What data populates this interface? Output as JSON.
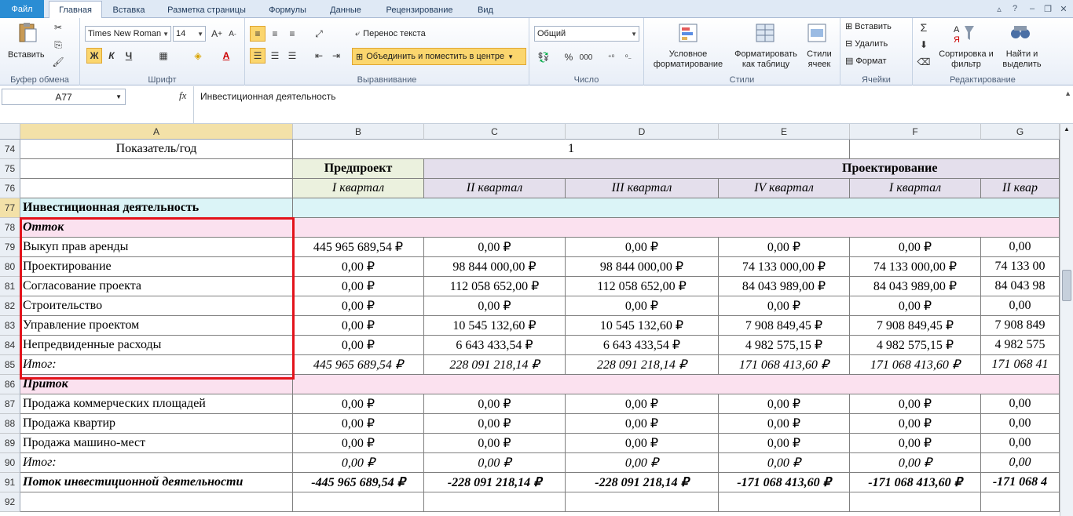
{
  "tabs": [
    "Файл",
    "Главная",
    "Вставка",
    "Разметка страницы",
    "Формулы",
    "Данные",
    "Рецензирование",
    "Вид"
  ],
  "ribbon": {
    "clipboard": {
      "paste": "Вставить",
      "label": "Буфер обмена"
    },
    "font": {
      "name": "Times New Roman",
      "size": "14",
      "bold": "Ж",
      "italic": "К",
      "underline": "Ч",
      "label": "Шрифт"
    },
    "alignment": {
      "wrap": "Перенос текста",
      "merge": "Объединить и поместить в центре",
      "label": "Выравнивание"
    },
    "number": {
      "format": "Общий",
      "percent": "%",
      "thousands": "000",
      "label": "Число"
    },
    "styles": {
      "conditional": "Условное форматирование",
      "as_table": "Форматировать как таблицу",
      "cell_styles": "Стили ячеек",
      "label": "Стили"
    },
    "cells": {
      "insert": "Вставить",
      "delete": "Удалить",
      "format": "Формат",
      "label": "Ячейки"
    },
    "editing": {
      "sort": "Сортировка и фильтр",
      "find": "Найти и выделить",
      "label": "Редактирование"
    }
  },
  "formula_bar": {
    "name_box": "A77",
    "fx": "fx",
    "content": "Инвестиционная деятельность"
  },
  "columns": [
    "A",
    "B",
    "C",
    "D",
    "E",
    "F",
    "G"
  ],
  "header_rows": {
    "r74": {
      "num": "74",
      "a": "Показатель/год",
      "year": "1"
    },
    "r75": {
      "num": "75",
      "b": "Предпроект",
      "c_g": "Проектирование"
    },
    "r76": {
      "num": "76",
      "b": "I квартал",
      "c": "II квартал",
      "d": "III квартал",
      "e": "IV квартал",
      "f": "I квартал",
      "g": "II квар"
    }
  },
  "rows": [
    {
      "num": "77",
      "a": "Инвестиционная деятельность",
      "style": "section"
    },
    {
      "num": "78",
      "a": "Отток",
      "style": "sub"
    },
    {
      "num": "79",
      "a": "Выкуп прав аренды",
      "vals": [
        "445 965 689,54 ₽",
        "0,00 ₽",
        "0,00 ₽",
        "0,00 ₽",
        "0,00 ₽",
        "0,00"
      ],
      "style": "data"
    },
    {
      "num": "80",
      "a": "Проектирование",
      "vals": [
        "0,00 ₽",
        "98 844 000,00 ₽",
        "98 844 000,00 ₽",
        "74 133 000,00 ₽",
        "74 133 000,00 ₽",
        "74 133 00"
      ],
      "style": "data"
    },
    {
      "num": "81",
      "a": "Согласование проекта",
      "vals": [
        "0,00 ₽",
        "112 058 652,00 ₽",
        "112 058 652,00 ₽",
        "84 043 989,00 ₽",
        "84 043 989,00 ₽",
        "84 043 98"
      ],
      "style": "data"
    },
    {
      "num": "82",
      "a": "Строительство",
      "vals": [
        "0,00 ₽",
        "0,00 ₽",
        "0,00 ₽",
        "0,00 ₽",
        "0,00 ₽",
        "0,00"
      ],
      "style": "data"
    },
    {
      "num": "83",
      "a": "Управление проектом",
      "vals": [
        "0,00 ₽",
        "10 545 132,60 ₽",
        "10 545 132,60 ₽",
        "7 908 849,45 ₽",
        "7 908 849,45 ₽",
        "7 908 849"
      ],
      "style": "data"
    },
    {
      "num": "84",
      "a": "Непредвиденные расходы",
      "vals": [
        "0,00 ₽",
        "6 643 433,54 ₽",
        "6 643 433,54 ₽",
        "4 982 575,15 ₽",
        "4 982 575,15 ₽",
        "4 982 575"
      ],
      "style": "data"
    },
    {
      "num": "85",
      "a": "Итог:",
      "vals": [
        "445 965 689,54 ₽",
        "228 091 218,14 ₽",
        "228 091 218,14 ₽",
        "171 068 413,60 ₽",
        "171 068 413,60 ₽",
        "171 068 41"
      ],
      "style": "total"
    },
    {
      "num": "86",
      "a": "Приток",
      "style": "sub"
    },
    {
      "num": "87",
      "a": "Продажа коммерческих площадей",
      "vals": [
        "0,00 ₽",
        "0,00 ₽",
        "0,00 ₽",
        "0,00 ₽",
        "0,00 ₽",
        "0,00"
      ],
      "style": "data"
    },
    {
      "num": "88",
      "a": "Продажа квартир",
      "vals": [
        "0,00 ₽",
        "0,00 ₽",
        "0,00 ₽",
        "0,00 ₽",
        "0,00 ₽",
        "0,00"
      ],
      "style": "data"
    },
    {
      "num": "89",
      "a": "Продажа машино-мест",
      "vals": [
        "0,00 ₽",
        "0,00 ₽",
        "0,00 ₽",
        "0,00 ₽",
        "0,00 ₽",
        "0,00"
      ],
      "style": "data"
    },
    {
      "num": "90",
      "a": "Итог:",
      "vals": [
        "0,00 ₽",
        "0,00 ₽",
        "0,00 ₽",
        "0,00 ₽",
        "0,00 ₽",
        "0,00"
      ],
      "style": "total"
    },
    {
      "num": "91",
      "a": "Поток инвестиционной деятельности",
      "vals": [
        "-445 965 689,54 ₽",
        "-228 091 218,14 ₽",
        "-228 091 218,14 ₽",
        "-171 068 413,60 ₽",
        "-171 068 413,60 ₽",
        "-171 068 4"
      ],
      "style": "flow"
    },
    {
      "num": "92",
      "a": "",
      "style": "empty"
    }
  ],
  "colors": {
    "accent": "#2a8dd4",
    "highlight": "#e3131b",
    "green": "#ebf1de",
    "lavender": "#e4dfec",
    "cyan": "#dbf4f7",
    "pink": "#fbe1ef"
  }
}
